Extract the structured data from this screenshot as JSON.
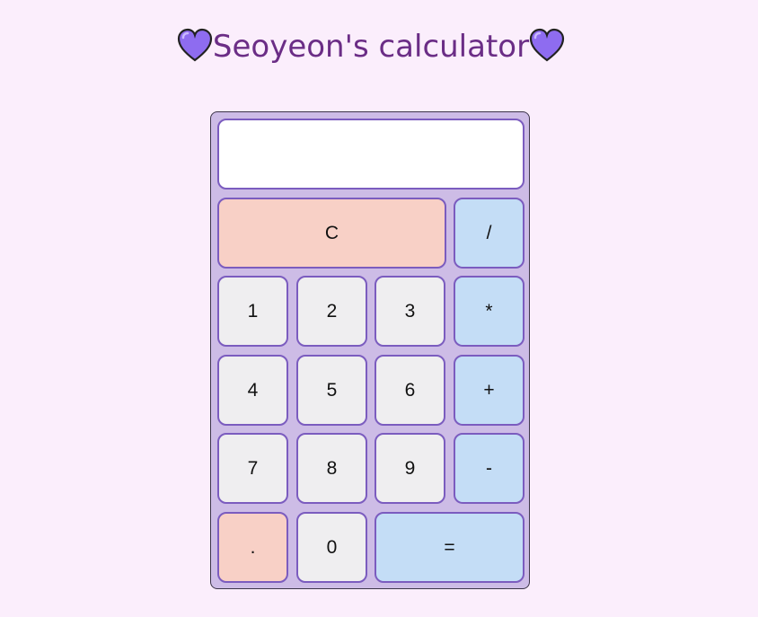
{
  "title": {
    "text": "Seoyeon's calculator",
    "left_icon": "purple-heart-icon",
    "right_icon": "purple-heart-icon"
  },
  "display": {
    "value": ""
  },
  "buttons": {
    "clear": "C",
    "divide": "/",
    "one": "1",
    "two": "2",
    "three": "3",
    "multiply": "*",
    "four": "4",
    "five": "5",
    "six": "6",
    "plus": "+",
    "seven": "7",
    "eight": "8",
    "nine": "9",
    "minus": "-",
    "decimal": ".",
    "zero": "0",
    "equals": "="
  },
  "colors": {
    "background": "#fbeefc",
    "calculator_body": "#cdbce6",
    "button_border": "#7b5cbf",
    "number_button": "#efeef0",
    "operator_button": "#c4ddf6",
    "clear_button": "#f8d0c6",
    "title_text": "#6b2d86",
    "heart": "#8e6cf0"
  }
}
